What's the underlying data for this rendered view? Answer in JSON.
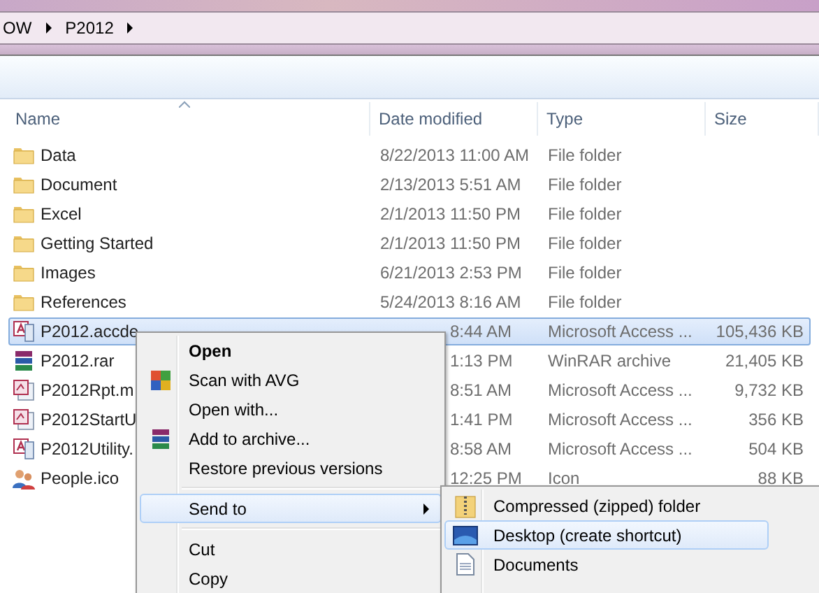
{
  "breadcrumb": [
    {
      "label": "OW"
    },
    {
      "label": "P2012"
    }
  ],
  "columns": [
    {
      "label": "Name",
      "sorted": true
    },
    {
      "label": "Date modified",
      "sorted": false
    },
    {
      "label": "Type",
      "sorted": false
    },
    {
      "label": "Size",
      "sorted": false
    }
  ],
  "files": [
    {
      "name": "Data",
      "kind": "folder",
      "date": "8/22/2013 11:00 AM",
      "type": "File folder",
      "selected": false
    },
    {
      "name": "Document",
      "kind": "folder",
      "date": "2/13/2013 5:51 AM",
      "type": "File folder",
      "selected": false
    },
    {
      "name": "Excel",
      "kind": "folder",
      "date": "2/1/2013 11:50 PM",
      "type": "File folder",
      "selected": false
    },
    {
      "name": "Getting Started",
      "kind": "folder",
      "date": "2/1/2013 11:50 PM",
      "type": "File folder",
      "selected": false
    },
    {
      "name": "Images",
      "kind": "folder",
      "date": "6/21/2013 2:53 PM",
      "type": "File folder",
      "selected": false
    },
    {
      "name": "References",
      "kind": "folder",
      "date": "5/24/2013 8:16 AM",
      "type": "File folder",
      "selected": false
    },
    {
      "name": "P2012.accde",
      "kind": "access",
      "date": "8:44 AM",
      "type": "Microsoft Access ...",
      "size": "105,436 KB",
      "selected": true
    },
    {
      "name": "P2012.rar",
      "kind": "archive",
      "date": "1:13 PM",
      "type": "WinRAR archive",
      "size": "21,405 KB",
      "selected": false
    },
    {
      "name": "P2012Rpt.m",
      "kind": "access-doc",
      "date": "8:51 AM",
      "type": "Microsoft Access ...",
      "size": "9,732 KB",
      "selected": false
    },
    {
      "name": "P2012StartU",
      "kind": "access-doc",
      "date": "1:41 PM",
      "type": "Microsoft Access ...",
      "size": "356 KB",
      "selected": false
    },
    {
      "name": "P2012Utility.",
      "kind": "access",
      "date": "8:58 AM",
      "type": "Microsoft Access ...",
      "size": "504 KB",
      "selected": false
    },
    {
      "name": "People.ico",
      "kind": "people",
      "date": "12:25 PM",
      "type": "Icon",
      "size": "88 KB",
      "selected": false
    }
  ],
  "context_menu": {
    "items": [
      {
        "kind": "item",
        "label": "Open",
        "bold": true,
        "submenu": false,
        "selected": false
      },
      {
        "kind": "item",
        "label": "Scan with AVG",
        "bold": false,
        "submenu": false,
        "selected": false
      },
      {
        "kind": "item",
        "label": "Open with...",
        "bold": false,
        "submenu": false,
        "selected": false
      },
      {
        "kind": "item",
        "label": "Add to archive...",
        "bold": false,
        "submenu": false,
        "selected": false
      },
      {
        "kind": "item",
        "label": "Restore previous versions",
        "bold": false,
        "submenu": false,
        "selected": false
      },
      {
        "kind": "separator"
      },
      {
        "kind": "item",
        "label": "Send to",
        "bold": false,
        "submenu": true,
        "selected": true
      },
      {
        "kind": "separator"
      },
      {
        "kind": "item",
        "label": "Cut",
        "bold": false,
        "submenu": false,
        "selected": false
      },
      {
        "kind": "item",
        "label": "Copy",
        "bold": false,
        "submenu": false,
        "selected": false
      }
    ]
  },
  "send_to_menu": {
    "items": [
      {
        "label": "Compressed (zipped) folder",
        "selected": false
      },
      {
        "label": "Desktop (create shortcut)",
        "selected": true
      },
      {
        "label": "Documents",
        "selected": false
      }
    ]
  }
}
